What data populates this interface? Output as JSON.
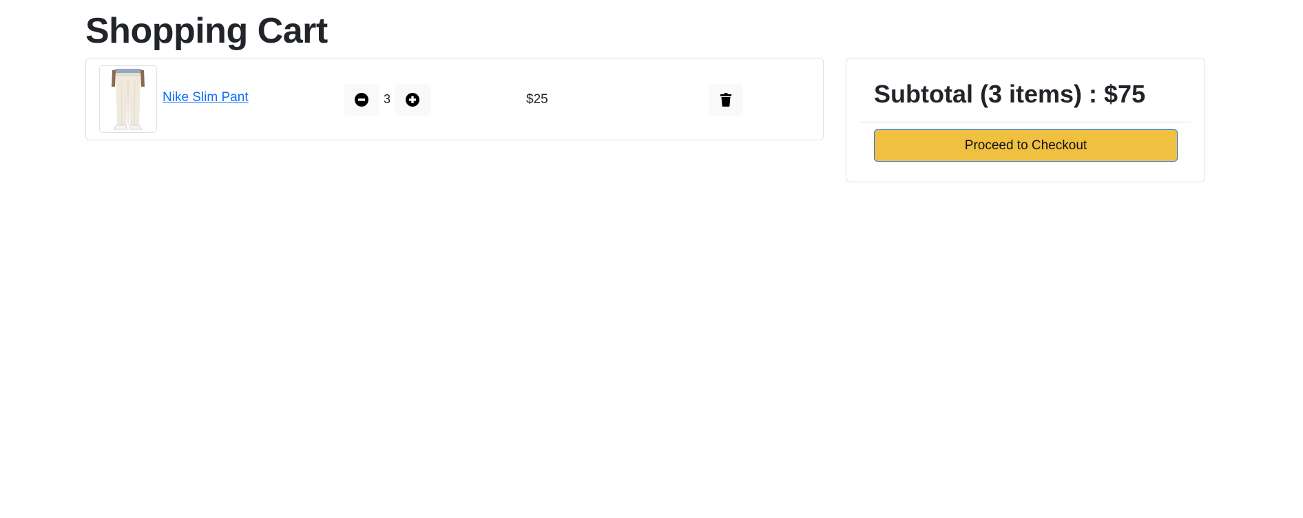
{
  "page": {
    "title": "Shopping Cart"
  },
  "cart": {
    "items": [
      {
        "name": "Nike Slim Pant",
        "quantity": "3",
        "price": "$25",
        "image_icon": "pants-product-image",
        "decrease_icon": "minus-circle-icon",
        "increase_icon": "plus-circle-icon",
        "delete_icon": "trash-icon"
      }
    ]
  },
  "summary": {
    "subtotal": "Subtotal (3 items) : $75",
    "checkout_label": "Proceed to Checkout"
  },
  "colors": {
    "link": "#0d6efd",
    "checkout_button": "#f0c040",
    "button_bg": "#f8f9fa",
    "border": "#dee2e6"
  }
}
